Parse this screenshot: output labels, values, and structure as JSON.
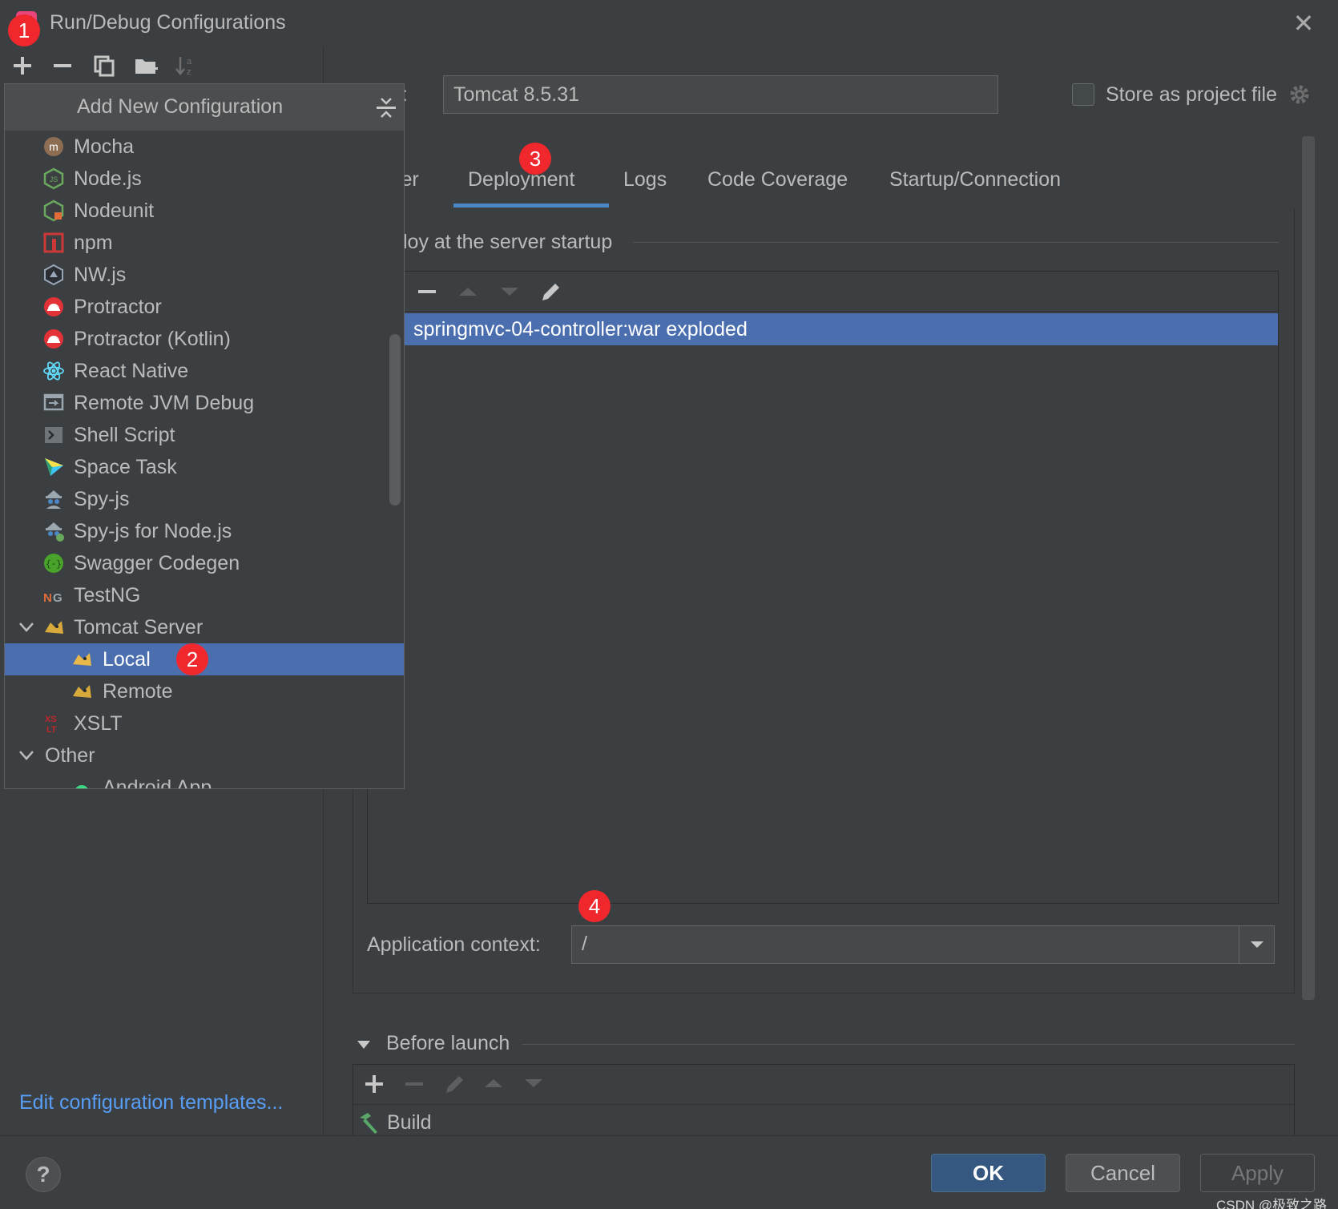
{
  "window": {
    "title": "Run/Debug Configurations"
  },
  "toolbar": {
    "add": "+",
    "remove": "−"
  },
  "popup": {
    "title": "Add New Configuration",
    "items": [
      {
        "label": "Mocha",
        "icon": "mocha-icon"
      },
      {
        "label": "Node.js",
        "icon": "nodejs-icon"
      },
      {
        "label": "Nodeunit",
        "icon": "nodeunit-icon"
      },
      {
        "label": "npm",
        "icon": "npm-icon"
      },
      {
        "label": "NW.js",
        "icon": "nwjs-icon"
      },
      {
        "label": "Protractor",
        "icon": "protractor-icon"
      },
      {
        "label": "Protractor (Kotlin)",
        "icon": "protractor-icon"
      },
      {
        "label": "React Native",
        "icon": "react-icon"
      },
      {
        "label": "Remote JVM Debug",
        "icon": "remote-debug-icon"
      },
      {
        "label": "Shell Script",
        "icon": "shell-icon"
      },
      {
        "label": "Space Task",
        "icon": "space-icon"
      },
      {
        "label": "Spy-js",
        "icon": "spyjs-icon"
      },
      {
        "label": "Spy-js for Node.js",
        "icon": "spyjs-icon"
      },
      {
        "label": "Swagger Codegen",
        "icon": "swagger-icon"
      },
      {
        "label": "TestNG",
        "icon": "testng-icon"
      },
      {
        "label": "Tomcat Server",
        "icon": "tomcat-icon"
      },
      {
        "label": "Local",
        "icon": "tomcat-icon"
      },
      {
        "label": "Remote",
        "icon": "tomcat-icon"
      },
      {
        "label": "XSLT",
        "icon": "xslt-icon"
      },
      {
        "label": "Other",
        "icon": "chevron-down-icon"
      },
      {
        "label": "Android App",
        "icon": "android-icon"
      }
    ],
    "selected": "Local"
  },
  "form": {
    "name_label": "e:",
    "name_value": "Tomcat 8.5.31",
    "store_label": "Store as project file",
    "store_checked": false
  },
  "tabs": [
    {
      "label": "ver"
    },
    {
      "label": "Deployment",
      "active": true
    },
    {
      "label": "Logs"
    },
    {
      "label": "Code Coverage"
    },
    {
      "label": "Startup/Connection"
    }
  ],
  "deployment": {
    "section_label": "loy at the server startup",
    "artifact": "springmvc-04-controller:war exploded",
    "context_label": "Application context:",
    "context_value": "/"
  },
  "before_launch": {
    "label": "Before launch",
    "tasks": [
      "Build"
    ]
  },
  "footer": {
    "edit_templates": "Edit configuration templates...",
    "help": "?",
    "ok": "OK",
    "cancel": "Cancel",
    "apply": "Apply",
    "watermark": "CSDN @极致之路"
  },
  "markers": [
    "1",
    "2",
    "3",
    "4"
  ],
  "colors": {
    "background": "#3c3f41",
    "selection": "#4b6eaf",
    "accent": "#4a88c7",
    "link": "#589df6",
    "marker": "#f0282d"
  }
}
